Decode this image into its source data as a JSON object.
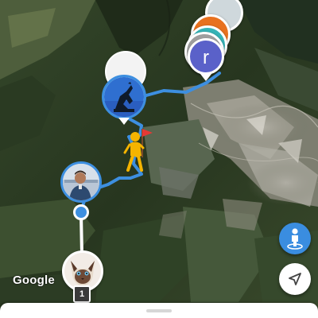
{
  "map": {
    "attribution": "Google"
  },
  "markers": {
    "cluster_top_initial": "r",
    "photo_count": "1"
  },
  "colors": {
    "route": "#3d8fe0",
    "accent_blue": "#3a8de0",
    "avatar_initial_bg": "#5a61c9",
    "cluster_orange": "#e8711f",
    "cluster_teal": "#36b3b6",
    "flag_red": "#e53935",
    "hiker_yellow": "#f5b400"
  },
  "icons": {
    "street_view_button": "pegman-icon",
    "locate_button": "navigation-arrow-icon",
    "flag_marker": "hiker-with-flag-icon"
  }
}
